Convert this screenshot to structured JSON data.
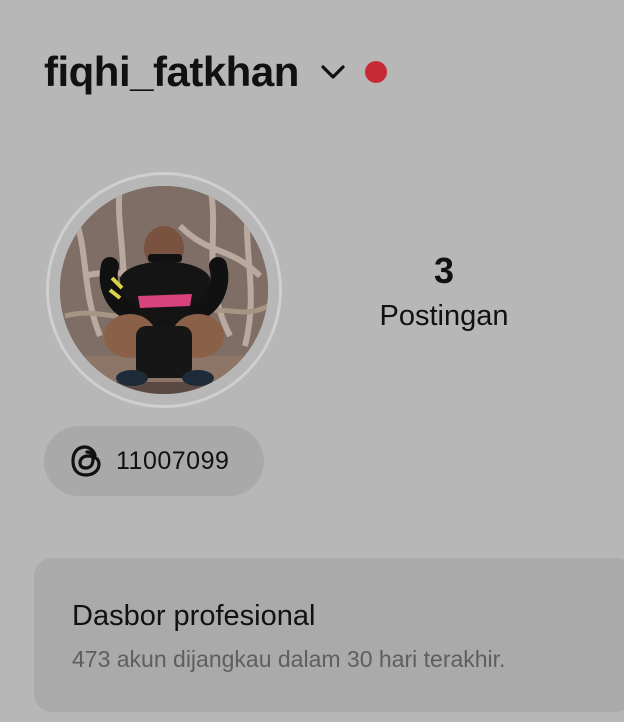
{
  "profile": {
    "username": "fiqhi_fatkhan",
    "notification_dot_color": "#c62a34",
    "chevron_icon": "chevron-down-icon"
  },
  "stats": {
    "posts_count": "3",
    "posts_label": "Postingan"
  },
  "threads": {
    "icon": "threads-icon",
    "count": "11007099"
  },
  "dashboard": {
    "title": "Dasbor profesional",
    "subtitle": "473 akun dijangkau dalam 30 hari terakhir."
  },
  "colors": {
    "background": "#b7b7b7",
    "pill": "#a9a9a9",
    "card": "#aaaaaa",
    "text": "#111111",
    "muted_text": "#5e5e5e"
  }
}
